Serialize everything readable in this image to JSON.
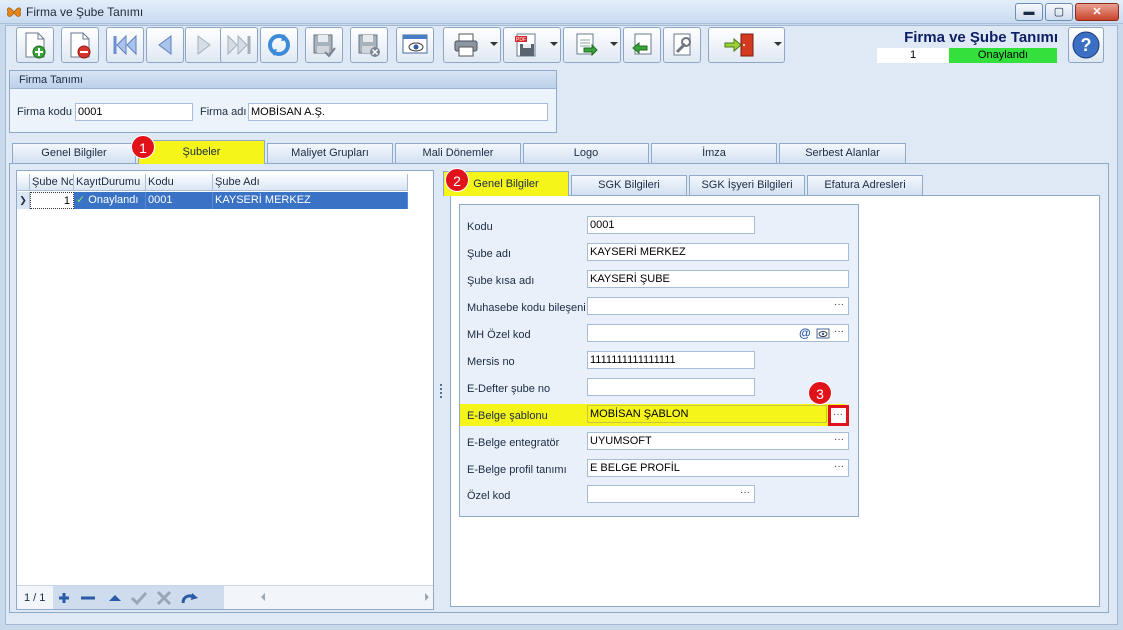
{
  "window": {
    "title": "Firma ve Şube Tanımı",
    "min": "▬",
    "max": "▢",
    "close": "✕"
  },
  "header": {
    "form_title": "Firma ve Şube Tanımı",
    "record_id": "1",
    "record_status": "Onaylandı",
    "status_color": "#33e03c"
  },
  "firma": {
    "group_title": "Firma Tanımı",
    "code_label": "Firma kodu",
    "code_value": "0001",
    "name_label": "Firma adı",
    "name_value": "MOBİSAN A.Ş."
  },
  "tabs": [
    "Genel Bilgiler",
    "Şubeler",
    "Maliyet Grupları",
    "Mali Dönemler",
    "Logo",
    "İmza",
    "Serbest Alanlar"
  ],
  "grid": {
    "columns": [
      "Şube No",
      "KayıtDurumu",
      "Kodu",
      "Şube Adı"
    ],
    "rows": [
      {
        "no": "1",
        "status": "Onaylandı",
        "code": "0001",
        "name": "KAYSERİ MERKEZ"
      }
    ],
    "pager": "1 / 1"
  },
  "subtabs": [
    "Genel Bilgiler",
    "SGK Bilgileri",
    "SGK İşyeri Bilgileri",
    "Efatura Adresleri"
  ],
  "fields": {
    "kodu_label": "Kodu",
    "kodu_value": "0001",
    "sube_adi_label": "Şube adı",
    "sube_adi_value": "KAYSERİ MERKEZ",
    "sube_kisa_label": "Şube kısa adı",
    "sube_kisa_value": "KAYSERİ ŞUBE",
    "muhasebe_label": "Muhasebe kodu bileşeni",
    "muhasebe_value": "",
    "mh_label": "MH Özel kod",
    "mh_value": "",
    "mersis_label": "Mersis no",
    "mersis_value": "1111111111111111",
    "edefter_label": "E-Defter şube no",
    "edefter_value": "",
    "ebelge_sablon_label": "E-Belge şablonu",
    "ebelge_sablon_value": "MOBİSAN ŞABLON",
    "ebelge_entegrator_label": "E-Belge entegratör",
    "ebelge_entegrator_value": "UYUMSOFT",
    "ebelge_profil_label": "E-Belge profil tanımı",
    "ebelge_profil_value": "E BELGE PROFİL",
    "ozel_kod_label": "Özel kod",
    "ozel_kod_value": ""
  },
  "badges": [
    "1",
    "2",
    "3"
  ],
  "colors": {
    "highlight": "#f5f51a",
    "badge": "#e2121b",
    "selection": "#3a73c6"
  }
}
